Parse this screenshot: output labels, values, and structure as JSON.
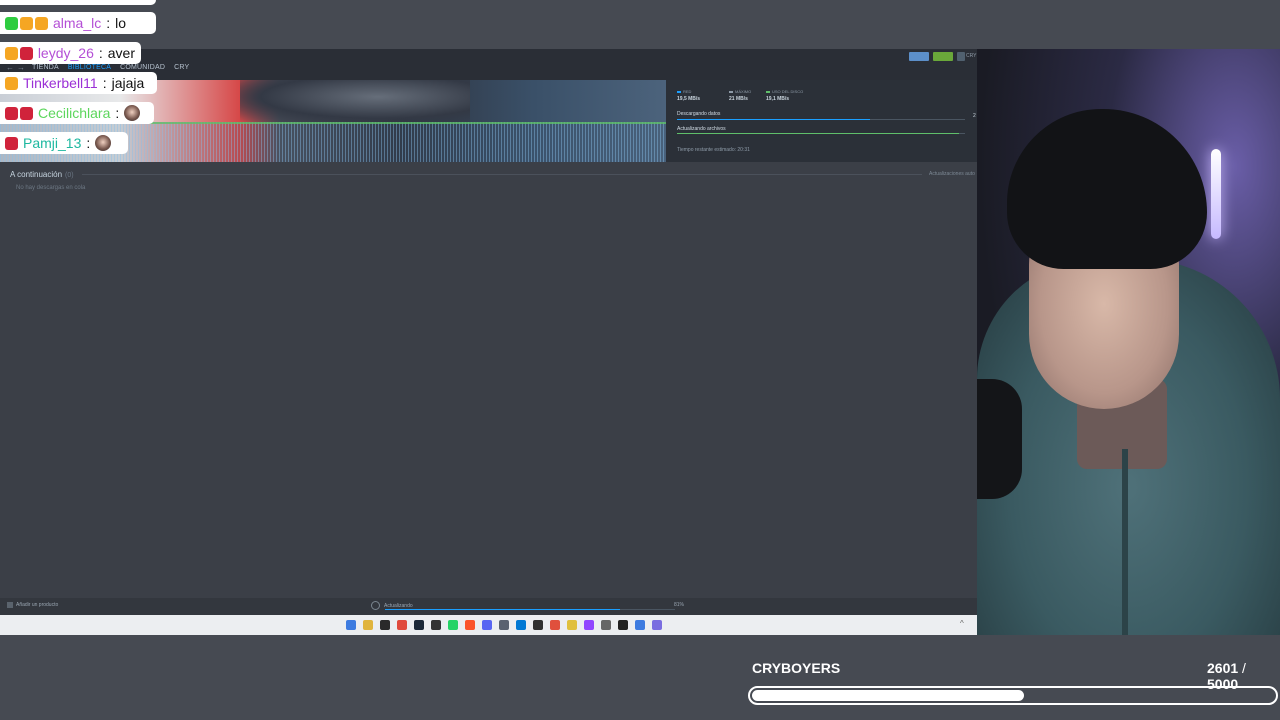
{
  "steam": {
    "nav": {
      "back": "←",
      "forward": "→",
      "links": [
        "TIENDA",
        "BIBLIOTECA",
        "COMUNIDAD",
        "CRY"
      ],
      "active_index": 1,
      "user_tag": "CRY"
    },
    "stats": {
      "current_label": "RED",
      "current_value": "19,5 MB/s",
      "peak_label": "MÁXIMO",
      "peak_value": "21 MB/s",
      "disk_label": "USO DEL DISCO",
      "disk_value": "19,1 MB/s"
    },
    "download": {
      "downloading_label": "Descargando datos",
      "downloading_progress": 0.67,
      "updating_label": "Actualizando archivos",
      "updating_progress": 0.98,
      "time_left": "Tiempo restante estimado: 20:31",
      "side_value": "2"
    },
    "queue": {
      "title": "A continuación",
      "count": "(0)",
      "auto_updates": "Actualizaciones auto",
      "empty_message": "No hay descargas en cola"
    },
    "footer": {
      "add_product": "Añadir un producto",
      "status": "Actualizando",
      "progress": 0.81,
      "percent": "81%"
    },
    "colors": {
      "accent": "#1a9fff",
      "graph_green": "#5fbf6a",
      "nav_bg": "#2a2e36",
      "window_bg": "#3b3f47"
    }
  },
  "taskbar": {
    "icons": [
      "windows-start-icon",
      "file-explorer-icon",
      "nvidia-icon",
      "chrome-icon",
      "steam-icon",
      "epic-icon",
      "whatsapp-icon",
      "brave-icon",
      "discord-icon",
      "calculator-icon",
      "vscode-icon",
      "obs-icon",
      "git-icon",
      "folder-icon",
      "twitch-icon",
      "settings-icon",
      "capcut-icon",
      "browser-icon",
      "app-icon"
    ],
    "caret": "^"
  },
  "chat": {
    "messages": [
      {
        "user": "alma_lc",
        "message": "lo",
        "color": "#b44fd6",
        "badges": [
          "#2ecc40",
          "#f5a623",
          "#f5a623"
        ]
      },
      {
        "user": "leydy_26",
        "message": "aver",
        "color": "#b44fd6",
        "badges": [
          "#f5a623",
          "#d0233b"
        ]
      },
      {
        "user": "Tinkerbell11",
        "message": "jajaja",
        "color": "#9b30d6",
        "badges": [
          "#f5a623"
        ]
      },
      {
        "user": "Cecilichlara",
        "message": "",
        "color": "#5cd65c",
        "badges": [
          "#d0233b",
          "#d0233b"
        ],
        "emote": "emote-face"
      },
      {
        "user": "Pamji_13",
        "message": "",
        "color": "#1fb8a0",
        "badges": [
          "#d0233b"
        ],
        "emote": "emote-face"
      }
    ]
  },
  "goal": {
    "title": "CRYBOYERS",
    "current": "2601",
    "separator": " / ",
    "target": "5000",
    "progress": 0.5202
  }
}
